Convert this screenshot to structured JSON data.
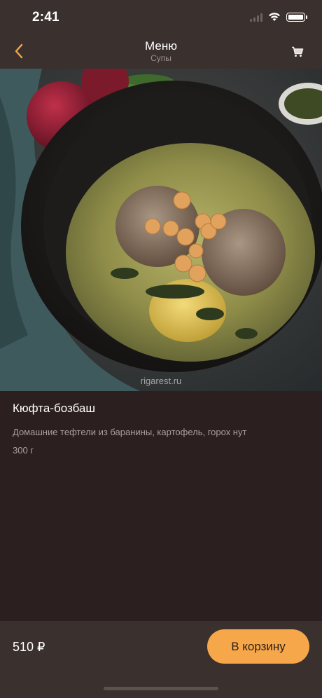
{
  "status_bar": {
    "time": "2:41"
  },
  "nav": {
    "title": "Меню",
    "subtitle": "Супы"
  },
  "hero": {
    "watermark": "rigarest.ru"
  },
  "dish": {
    "name": "Кюфта-бозбаш",
    "description": "Домашние тефтели из баранины, картофель, горох нут",
    "weight": "300 г"
  },
  "bottom_bar": {
    "price": "510 ₽",
    "add_to_cart_label": "В корзину"
  },
  "colors": {
    "accent": "#f6a74a",
    "background": "#2b201f",
    "bar": "#3a302d"
  }
}
